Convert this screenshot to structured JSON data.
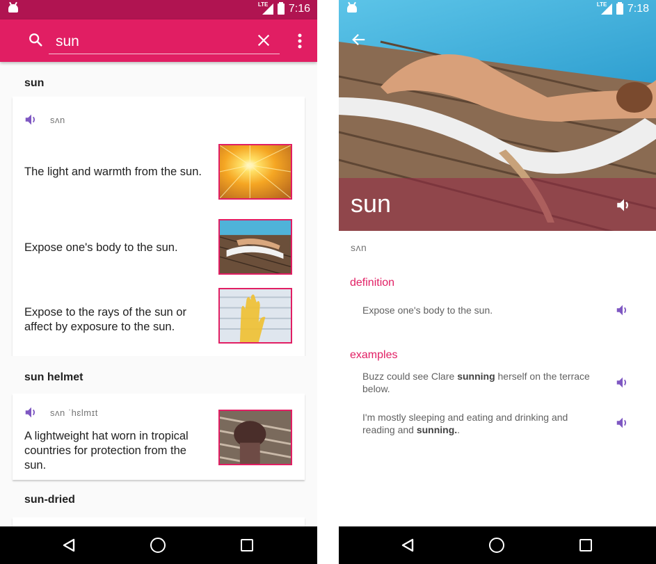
{
  "left_screen": {
    "status": {
      "time": "7:16",
      "network": "LTE"
    },
    "search": {
      "query": "sun"
    },
    "groups": [
      {
        "heading": "sun",
        "pronunciation": "sʌn",
        "senses": [
          {
            "definition": "The light and warmth from the sun.",
            "image": "sun-rays-image"
          },
          {
            "definition": "Expose one's body to the sun.",
            "image": "sunbathing-woman-image"
          },
          {
            "definition": "Expose to the rays of the sun or affect by exposure to the sun.",
            "image": "hand-in-sunlight-image"
          }
        ]
      },
      {
        "heading": "sun helmet",
        "pronunciation": "sʌn ˈhɛlmɪt",
        "senses": [
          {
            "definition": "A lightweight hat worn in tropical countries for protection from the sun.",
            "image": "sun-helmet-image"
          }
        ]
      },
      {
        "heading": "sun-dried"
      }
    ]
  },
  "right_screen": {
    "status": {
      "time": "7:18",
      "network": "LTE"
    },
    "word": "sun",
    "pronunciation": "sʌn",
    "definition_label": "definition",
    "definition": "Expose one's body to the sun.",
    "examples_label": "examples",
    "examples": [
      {
        "before": "Buzz could see Clare ",
        "bold": "sunning",
        "after": " herself on the terrace below."
      },
      {
        "before": "I'm mostly sleeping and eating and drinking and reading and ",
        "bold": "sunning.",
        "after": "."
      }
    ]
  },
  "colors": {
    "primary": "#e11e63",
    "primary_dark": "#b01451",
    "speaker": "#7e57c2",
    "hero_overlay": "#96284699"
  },
  "icons": [
    "search-icon",
    "close-icon",
    "more-vert-icon",
    "speaker-icon",
    "back-arrow-icon",
    "nav-back-icon",
    "nav-home-icon",
    "nav-recents-icon"
  ]
}
